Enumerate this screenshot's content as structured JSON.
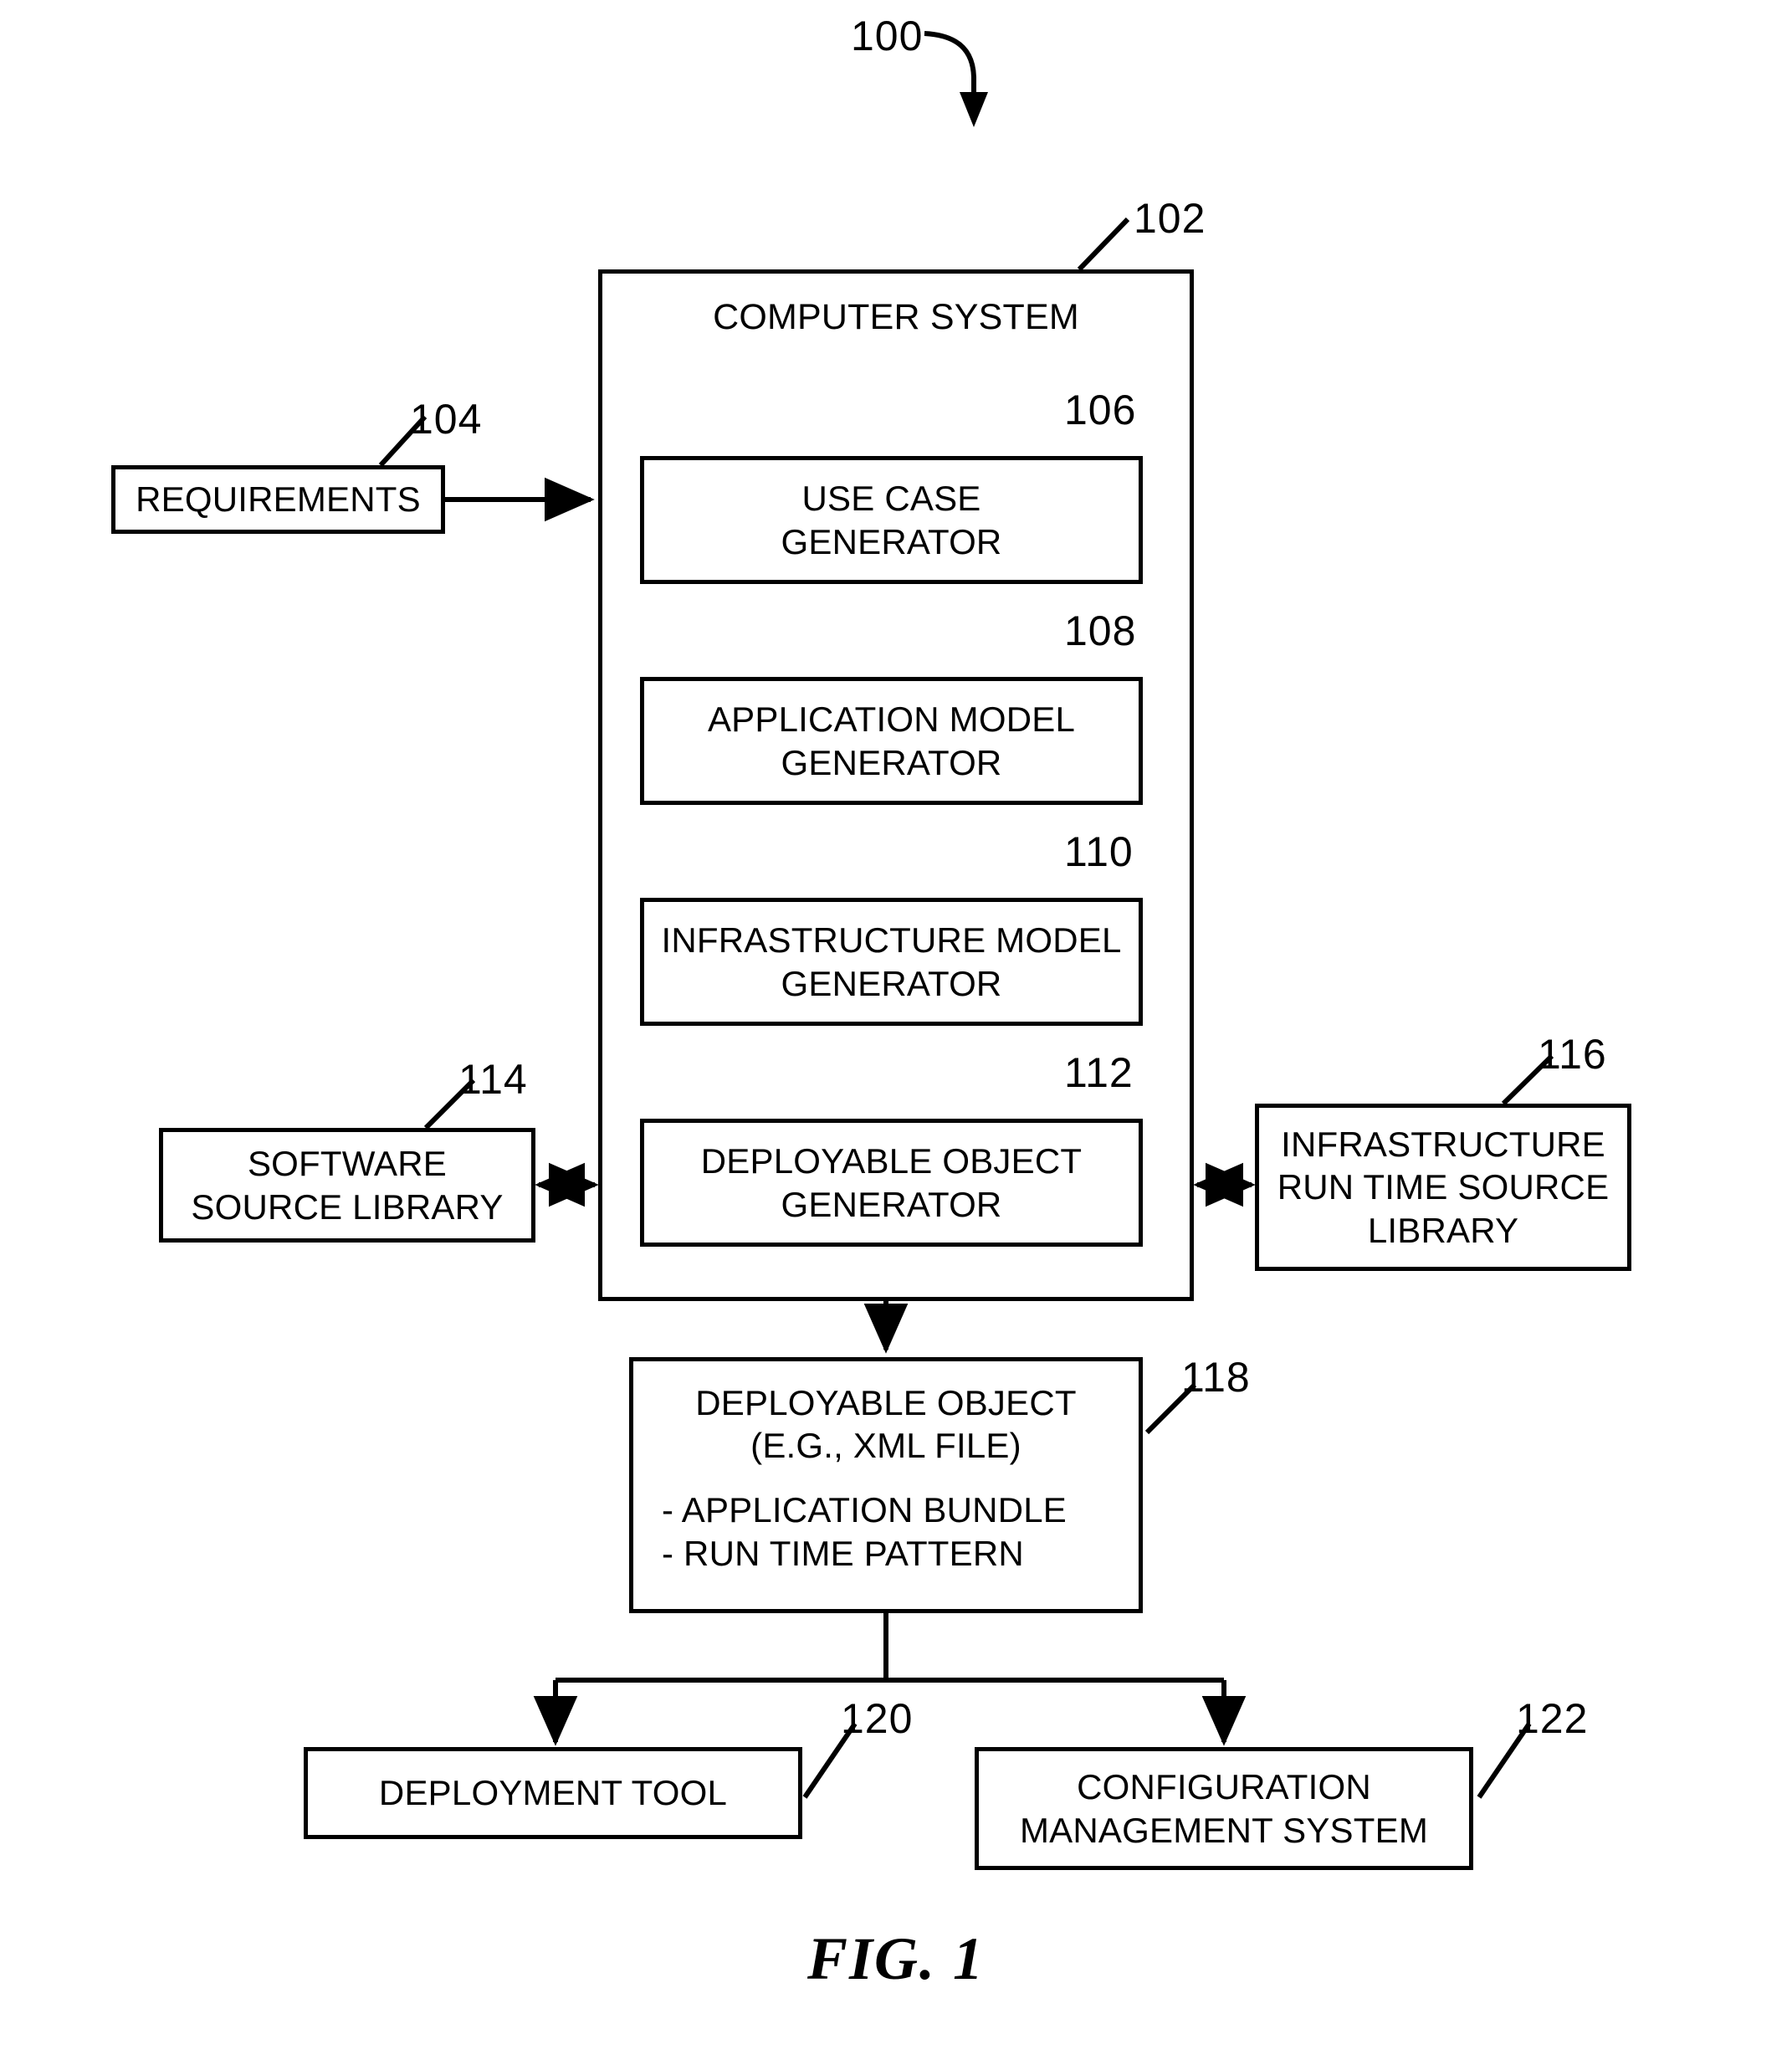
{
  "figure": {
    "caption": "FIG. 1",
    "overall_ref": "100"
  },
  "blocks": {
    "computer_system": {
      "label": "COMPUTER SYSTEM",
      "ref": "102"
    },
    "requirements": {
      "label": "REQUIREMENTS",
      "ref": "104"
    },
    "use_case_generator": {
      "line1": "USE CASE",
      "line2": "GENERATOR",
      "ref": "106"
    },
    "application_model_generator": {
      "line1": "APPLICATION MODEL",
      "line2": "GENERATOR",
      "ref": "108"
    },
    "infrastructure_model_generator": {
      "line1": "INFRASTRUCTURE MODEL",
      "line2": "GENERATOR",
      "ref": "110"
    },
    "deployable_object_generator": {
      "line1": "DEPLOYABLE OBJECT",
      "line2": "GENERATOR",
      "ref": "112"
    },
    "software_source_library": {
      "line1": "SOFTWARE",
      "line2": "SOURCE LIBRARY",
      "ref": "114"
    },
    "infrastructure_runtime_source_library": {
      "line1": "INFRASTRUCTURE",
      "line2": "RUN TIME SOURCE",
      "line3": "LIBRARY",
      "ref": "116"
    },
    "deployable_object": {
      "line1": "DEPLOYABLE OBJECT",
      "line2": "(E.G., XML FILE)",
      "bullet1": "- APPLICATION BUNDLE",
      "bullet2": "- RUN TIME PATTERN",
      "ref": "118"
    },
    "deployment_tool": {
      "label": "DEPLOYMENT TOOL",
      "ref": "120"
    },
    "configuration_management_system": {
      "line1": "CONFIGURATION",
      "line2": "MANAGEMENT SYSTEM",
      "ref": "122"
    }
  },
  "connections": [
    {
      "from": "requirements",
      "to": "computer_system",
      "style": "arrow-right"
    },
    {
      "from": "use_case_generator",
      "to": "application_model_generator",
      "style": "arrow-down"
    },
    {
      "from": "application_model_generator",
      "to": "infrastructure_model_generator",
      "style": "arrow-down"
    },
    {
      "from": "infrastructure_model_generator",
      "to": "deployable_object_generator",
      "style": "arrow-down"
    },
    {
      "from": "software_source_library",
      "to": "computer_system",
      "style": "double-arrow-horizontal"
    },
    {
      "from": "computer_system",
      "to": "infrastructure_runtime_source_library",
      "style": "double-arrow-horizontal"
    },
    {
      "from": "deployable_object_generator",
      "to": "deployable_object",
      "style": "arrow-down"
    },
    {
      "from": "deployable_object",
      "to": "deployment_tool",
      "style": "branch-arrow-down"
    },
    {
      "from": "deployable_object",
      "to": "configuration_management_system",
      "style": "branch-arrow-down"
    }
  ],
  "style": {
    "line_color": "#000000",
    "background": "#ffffff"
  }
}
